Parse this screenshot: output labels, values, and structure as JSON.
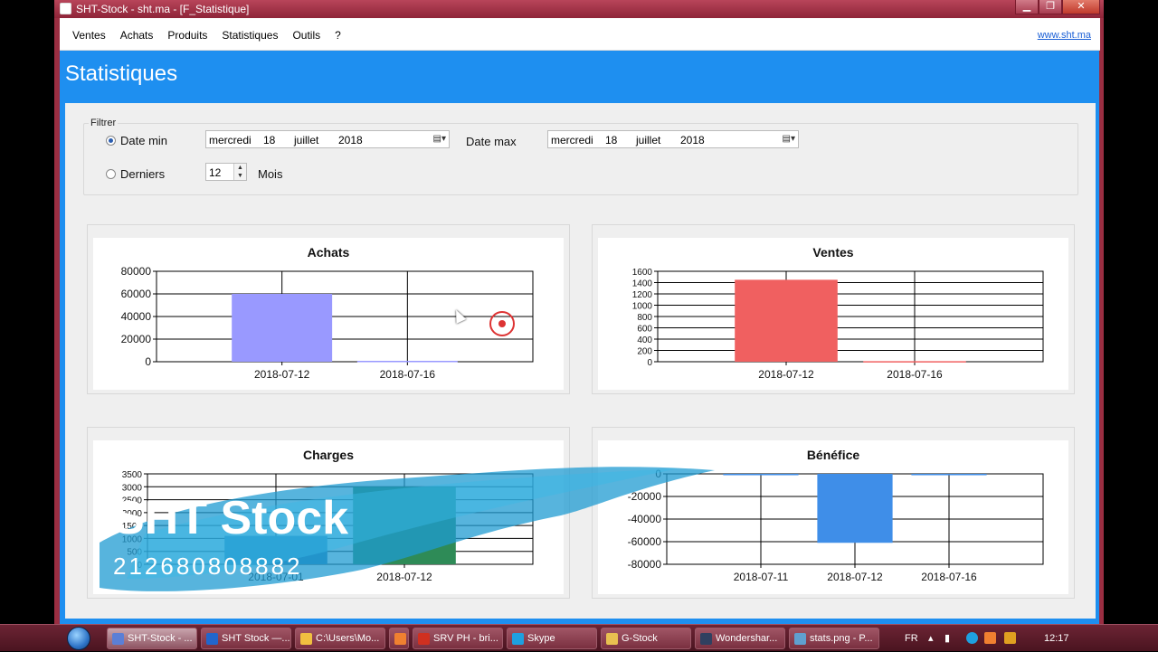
{
  "window": {
    "title": "SHT-Stock - sht.ma - [F_Statistique]",
    "buttons": [
      "▁",
      "❐",
      "✕"
    ]
  },
  "menu": {
    "items": [
      "Ventes",
      "Achats",
      "Produits",
      "Statistiques",
      "Outils",
      "?"
    ],
    "link": "www.sht.ma"
  },
  "page": {
    "title": "Statistiques"
  },
  "filter": {
    "legend": "Filtrer",
    "date_min_label": "Date min",
    "date_max_label": "Date max",
    "derniers_label": "Derniers",
    "mois_label": "Mois",
    "date_min": {
      "day_name": "mercredi",
      "day": "18",
      "month": "juillet",
      "year": "2018"
    },
    "date_max": {
      "day_name": "mercredi",
      "day": "18",
      "month": "juillet",
      "year": "2018"
    },
    "months_value": "12",
    "selected": "date_min"
  },
  "chart_data": [
    {
      "type": "bar",
      "title": "Achats",
      "categories": [
        "2018-07-12",
        "2018-07-16"
      ],
      "values": [
        60000,
        800
      ],
      "ylim": [
        0,
        80000
      ],
      "yticks": [
        "80000",
        "60000",
        "40000",
        "20000",
        "0"
      ],
      "color": "#9999ff",
      "grid": true
    },
    {
      "type": "bar",
      "title": "Ventes",
      "categories": [
        "2018-07-12",
        "2018-07-16"
      ],
      "values": [
        1450,
        10
      ],
      "ylim": [
        0,
        1600
      ],
      "yticks": [
        "1600",
        "1400",
        "1200",
        "1000",
        "800",
        "600",
        "400",
        "200",
        "0"
      ],
      "color": "#f06060",
      "grid": true
    },
    {
      "type": "bar",
      "title": "Charges",
      "categories": [
        "2018-07-01",
        "2018-07-12"
      ],
      "values": [
        1100,
        3000
      ],
      "ylim": [
        0,
        3500
      ],
      "yticks": [
        "3500",
        "3000",
        "2500",
        "2000",
        "1500",
        "1000",
        "500",
        "0"
      ],
      "colors": [
        "#2c7fb8",
        "#2e8b57"
      ],
      "grid": true
    },
    {
      "type": "bar",
      "title": "Bénéfice",
      "categories": [
        "2018-07-11",
        "2018-07-12",
        "2018-07-16"
      ],
      "values": [
        -200,
        -61000,
        -800
      ],
      "ylim": [
        -80000,
        0
      ],
      "yticks": [
        "0",
        "-20000",
        "-40000",
        "-60000",
        "-80000"
      ],
      "color": "#3f8ee8",
      "grid": true
    }
  ],
  "watermark": {
    "line1": "SHT Stock",
    "line2": "212680808882"
  },
  "taskbar": {
    "items": [
      {
        "label": "SHT-Stock - ...",
        "color": "#5b7fd6"
      },
      {
        "label": "SHT Stock —...",
        "color": "#2266cc"
      },
      {
        "label": "C:\\Users\\Mo...",
        "color": "#f0c040"
      },
      {
        "label": "",
        "color": "#f08030"
      },
      {
        "label": "SRV PH - bri...",
        "color": "#d03020"
      },
      {
        "label": "Skype",
        "color": "#1ea0e0"
      },
      {
        "label": "G-Stock",
        "color": "#e8c050"
      },
      {
        "label": "Wondershar...",
        "color": "#304060"
      },
      {
        "label": "stats.png - P...",
        "color": "#60a0d0"
      }
    ],
    "lang": "FR",
    "clock": "12:17"
  }
}
